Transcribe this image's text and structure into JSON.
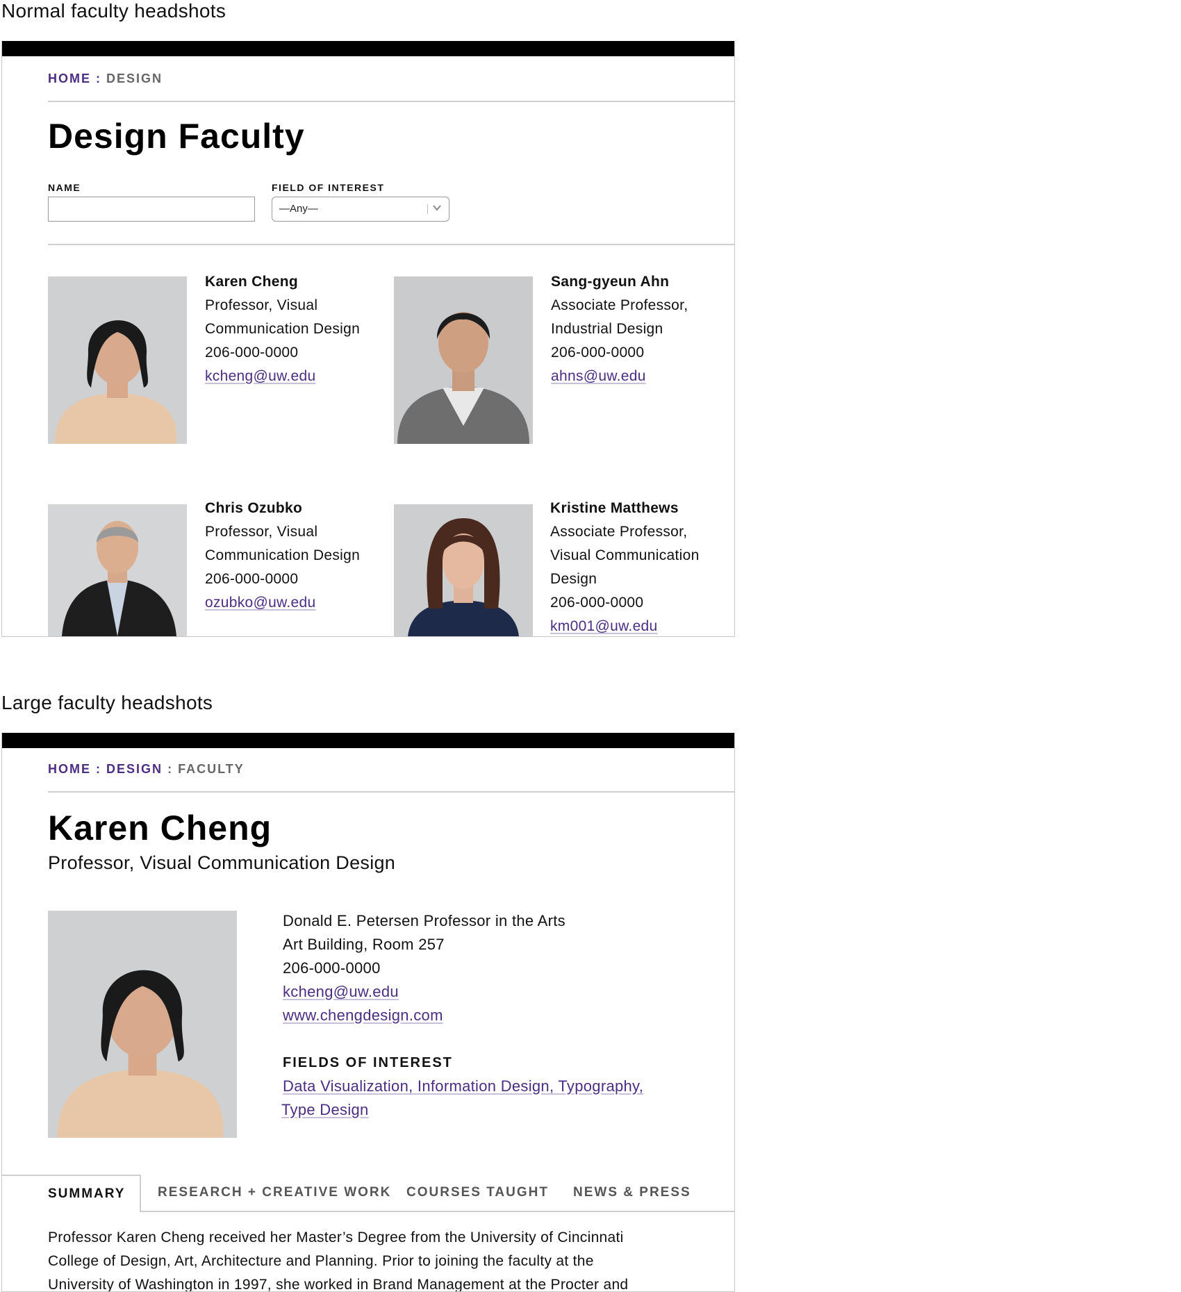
{
  "section1": {
    "caption": "Normal faculty headshots",
    "breadcrumb": {
      "home": "HOME",
      "sep": ":",
      "current": "DESIGN"
    },
    "title": "Design Faculty",
    "filters": {
      "name_label": "NAME",
      "name_value": "",
      "field_label": "FIELD OF INTEREST",
      "field_value": "—Any—"
    },
    "faculty": [
      {
        "name": "Karen Cheng",
        "title_lines": [
          "Professor, Visual",
          "Communication Design"
        ],
        "phone": "206-000-0000",
        "email": "kcheng@uw.edu"
      },
      {
        "name": "Sang-gyeun Ahn",
        "title_lines": [
          "Associate Professor,",
          "Industrial Design"
        ],
        "phone": "206-000-0000",
        "email": "ahns@uw.edu"
      },
      {
        "name": "Chris Ozubko",
        "title_lines": [
          "Professor, Visual",
          "Communication Design"
        ],
        "phone": "206-000-0000",
        "email": "ozubko@uw.edu"
      },
      {
        "name": "Kristine Matthews",
        "title_lines": [
          "Associate Professor,",
          "Visual Communication",
          "Design"
        ],
        "phone": "206-000-0000",
        "email": "km001@uw.edu"
      }
    ]
  },
  "section2": {
    "caption": "Large faculty headshots",
    "breadcrumb": {
      "home": "HOME",
      "sep1": ":",
      "design": "DESIGN",
      "sep2": ":",
      "current": "FACULTY"
    },
    "name": "Karen Cheng",
    "subtitle": "Professor, Visual Communication Design",
    "details": {
      "chair": "Donald E. Petersen Professor in the Arts",
      "office": "Art Building, Room 257",
      "phone": "206-000-0000",
      "email": "kcheng@uw.edu",
      "website": "www.chengdesign.com"
    },
    "fields_heading": "FIELDS OF INTEREST",
    "fields_line1": "Data Visualization, Information Design, Typography,",
    "fields_line2": "Type Design",
    "tabs": [
      "SUMMARY",
      "RESEARCH + CREATIVE WORK",
      "COURSES TAUGHT",
      "NEWS & PRESS"
    ],
    "summary_lines": [
      "Professor Karen Cheng received her Master’s Degree from the University of Cincinnati",
      "College of Design, Art, Architecture and Planning. Prior to joining the faculty at the",
      "University of Washington in 1997, she worked in Brand Management at the Procter and"
    ]
  }
}
